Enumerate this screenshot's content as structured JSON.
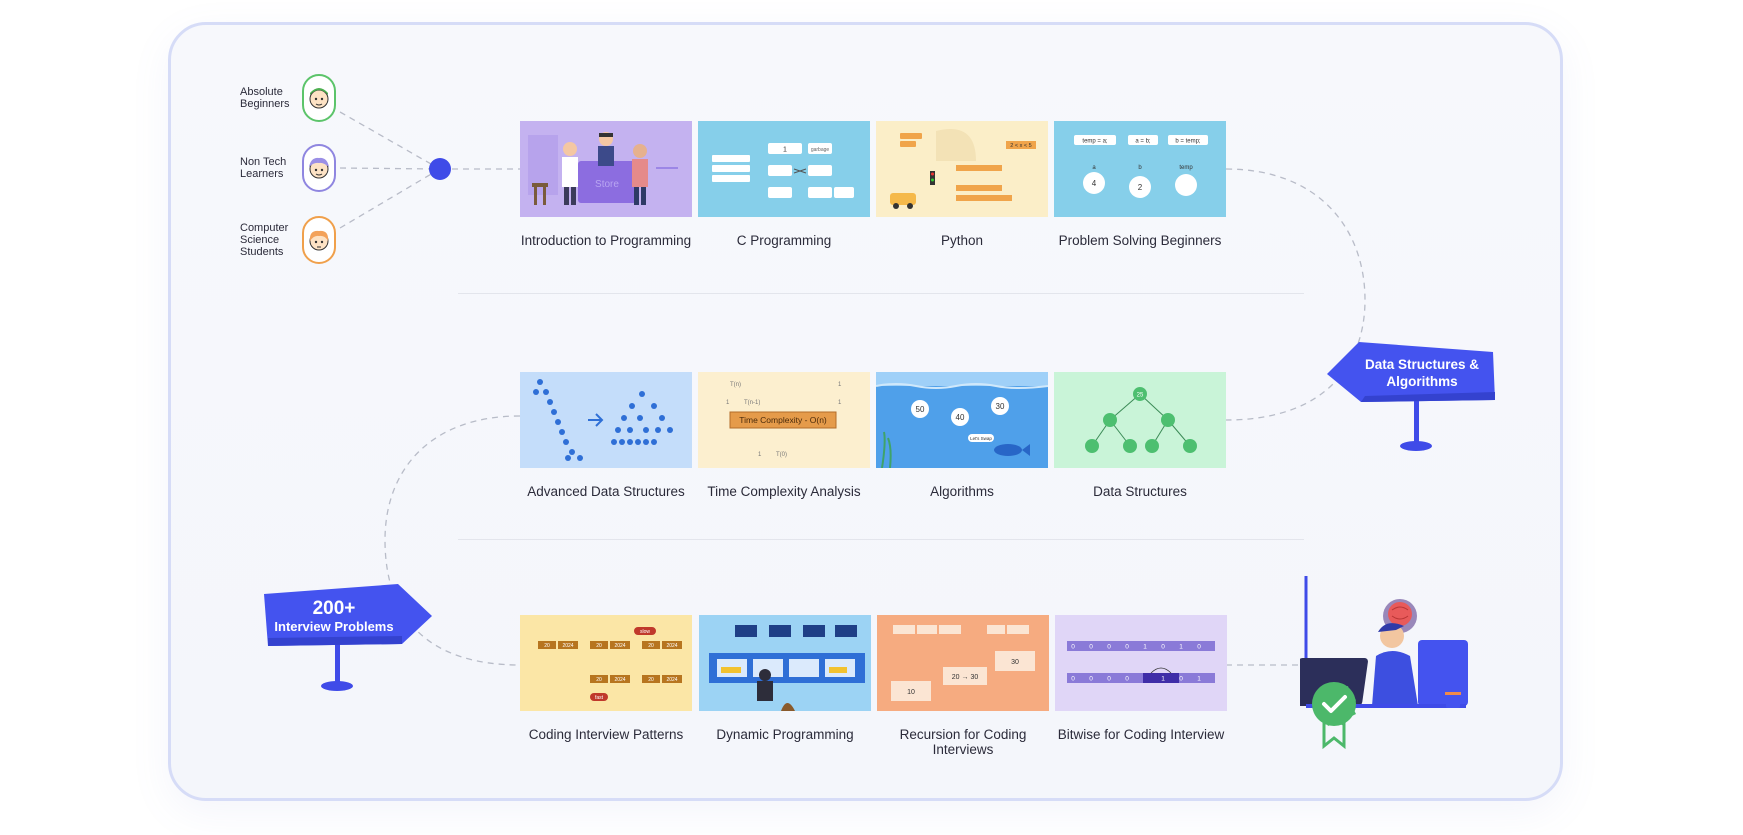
{
  "audiences": [
    {
      "label": "Absolute Beginners",
      "color": "#5cc46a",
      "icon": "beginner-avatar-icon"
    },
    {
      "label": "Non Tech Learners",
      "color": "#8f86e0",
      "icon": "non-tech-avatar-icon"
    },
    {
      "label": "Computer Science Students",
      "color": "#f0a04b",
      "icon": "cs-student-avatar-icon"
    }
  ],
  "courses": {
    "row1": [
      {
        "title": "Introduction to Programming",
        "bg": "#c7b6f2"
      },
      {
        "title": "C Programming",
        "bg": "#8fd3ec"
      },
      {
        "title": "Python",
        "bg": "#fbeec8"
      },
      {
        "title": "Problem Solving Beginners",
        "bg": "#8fd3ec"
      }
    ],
    "row2": [
      {
        "title": "Advanced Data Structures",
        "bg": "#c9e1fb"
      },
      {
        "title": "Time Complexity Analysis",
        "bg": "#fcefcf"
      },
      {
        "title": "Algorithms",
        "bg": "#5aa8ec"
      },
      {
        "title": "Data Structures",
        "bg": "#cdf6dc"
      }
    ],
    "row3": [
      {
        "title": "Coding Interview Patterns",
        "bg": "#fbe7a8"
      },
      {
        "title": "Dynamic Programming",
        "bg": "#9ed5f5"
      },
      {
        "title": "Recursion for Coding Interviews",
        "bg": "#f8ae84"
      },
      {
        "title": "Bitwise for Coding Interview",
        "bg": "#e2d8f8"
      }
    ]
  },
  "signs": {
    "dsa": {
      "line1": "Data Structures &",
      "line2": "Algorithms"
    },
    "interview": {
      "line1": "200+",
      "line2": "Interview Problems"
    }
  },
  "thumb_text": {
    "intro_store": "Store",
    "tc_label": "Time Complexity - O(n)",
    "tc_tn": "T(n)",
    "tc_tn1": "T(n-1)",
    "tc_t0": "T(0)",
    "tc_one": "1",
    "cprog_one": "1",
    "cprog_garbage": "garbage",
    "python_pos": "2 < x < 5",
    "ps_a": "a",
    "ps_b": "b",
    "ps_temp": "temp",
    "ps_four": "4",
    "ps_two": "2",
    "ps_code1": "temp = a;",
    "ps_code2": "a = b;",
    "ps_code3": "b = temp;",
    "algo_50": "50",
    "algo_40": "40",
    "algo_30": "30",
    "algo_bubble": "Let's Swap",
    "rec_10": "10",
    "rec_20_30": "20 → 30",
    "rec_30": "30",
    "cip_20": "20",
    "cip_2024": "2024",
    "cip_slow": "slow",
    "cip_fast": "fast",
    "bit_0": "0",
    "bit_1": "1",
    "ds_node": "25"
  },
  "accent": "#3f4be8",
  "check_color": "#4cb86a"
}
